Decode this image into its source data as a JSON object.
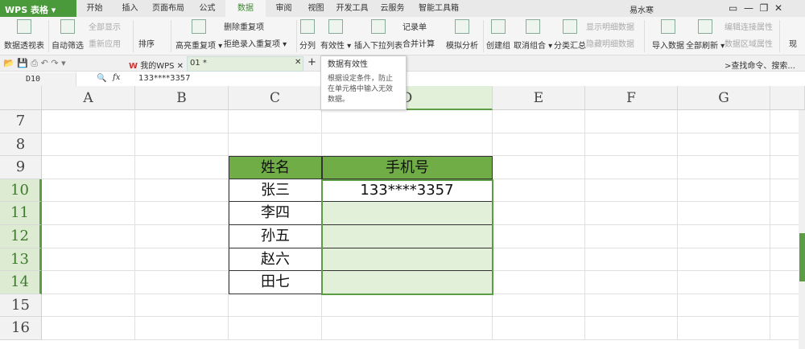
{
  "app": {
    "title": "WPS 表格"
  },
  "tabs": [
    "开始",
    "插入",
    "页面布局",
    "公式",
    "数据",
    "审阅",
    "视图",
    "开发工具",
    "云服务",
    "智能工具箱"
  ],
  "active_tab": "数据",
  "user": {
    "name": "易水寒"
  },
  "ribbon": {
    "pivot": "数据透视表",
    "autofilter": "自动筛选",
    "show_all": "全部显示",
    "reapply": "重新应用",
    "sort": "排序",
    "highlight_dup": "高亮重复项 ▾",
    "delete_dup": "删除重复项",
    "reject_dup": "拒绝录入重复项 ▾",
    "split": "分列",
    "validity": "有效性 ▾",
    "insert_dropdown": "插入下拉列表",
    "record": "记录单",
    "consolidate": "合并计算",
    "whatif": "模拟分析",
    "create_group": "创建组",
    "ungroup": "取消组合 ▾",
    "subtotal": "分类汇总",
    "show_detail": "显示明细数据",
    "hide_detail": "隐藏明细数据",
    "import": "导入数据",
    "refresh_all": "全部刷新 ▾",
    "edit_link": "编辑连接属性",
    "range_prop": "数据区域属性",
    "more": "现"
  },
  "doc_tabs": {
    "mywps": "我的WPS",
    "file": "01 *"
  },
  "search_cmd": ">查找命令、搜索...",
  "formula": {
    "namebox": "D10",
    "fx": "fx",
    "value": "133****3357"
  },
  "tooltip": {
    "title": "数据有效性",
    "body": "根据设定条件，防止在单元格中输入无效数据。"
  },
  "columns": [
    "A",
    "B",
    "C",
    "D",
    "E",
    "F",
    "G"
  ],
  "rows": [
    "7",
    "8",
    "9",
    "10",
    "11",
    "12",
    "13",
    "14",
    "15",
    "16"
  ],
  "table": {
    "headers": [
      "姓名",
      "手机号"
    ],
    "names": [
      "张三",
      "李四",
      "孙五",
      "赵六",
      "田七"
    ],
    "phones": [
      "133****3357",
      "",
      "",
      "",
      ""
    ]
  },
  "colors": {
    "accent": "#70ad47",
    "sel": "#e2efd9"
  }
}
